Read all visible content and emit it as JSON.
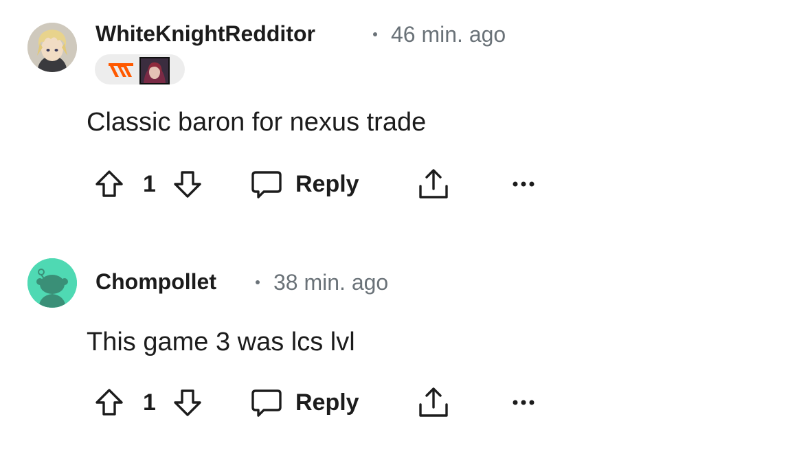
{
  "comments": [
    {
      "username": "WhiteKnightRedditor",
      "timestamp": "46 min. ago",
      "avatar_icon": "anime-avatar-icon",
      "flair": {
        "team_logo_icon": "fnatic-logo-icon",
        "champion_icon": "champion-portrait-icon",
        "logo_color": "#ff5900"
      },
      "body": "Classic baron for nexus trade",
      "votes": "1",
      "reply_label": "Reply"
    },
    {
      "username": "Chompollet",
      "timestamp": "38 min. ago",
      "avatar_icon": "snoo-avatar-icon",
      "avatar_color": "#4fd9b3",
      "body": "This game 3 was lcs lvl",
      "votes": "1",
      "reply_label": "Reply"
    }
  ],
  "icons": {
    "upvote": "upvote-arrow-icon",
    "downvote": "downvote-arrow-icon",
    "reply": "speech-bubble-icon",
    "share": "share-icon",
    "more": "more-options-icon"
  }
}
